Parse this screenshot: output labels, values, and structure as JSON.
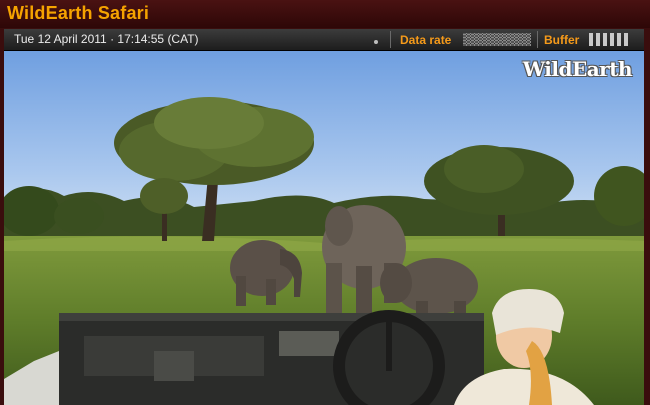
{
  "app": {
    "title": "WildEarth Safari"
  },
  "status": {
    "datetime": "Tue 12 April 2011 · 17:14:55 (CAT)",
    "data_rate_label": "Data rate",
    "buffer_label": "Buffer"
  },
  "video": {
    "watermark": "WildEarth"
  },
  "colors": {
    "title": "#f5a300",
    "accent": "#f59a1a",
    "background": "#3a0d0d"
  }
}
